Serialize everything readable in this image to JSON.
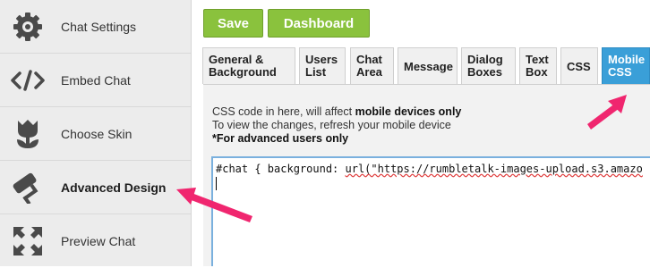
{
  "sidebar": {
    "items": [
      {
        "label": "Chat Settings",
        "icon": "gear-icon"
      },
      {
        "label": "Embed Chat",
        "icon": "code-icon"
      },
      {
        "label": "Choose Skin",
        "icon": "tulip-icon"
      },
      {
        "label": "Advanced Design",
        "icon": "paint-roller-icon",
        "active": true
      },
      {
        "label": "Preview Chat",
        "icon": "expand-icon"
      }
    ]
  },
  "toolbar": {
    "save_label": "Save",
    "dashboard_label": "Dashboard"
  },
  "tabs": [
    {
      "line1": "General &",
      "line2": "Background"
    },
    {
      "line1": "Users",
      "line2": "List"
    },
    {
      "line1": "Chat",
      "line2": "Area"
    },
    {
      "line1": "Message",
      "line2": ""
    },
    {
      "line1": "Dialog",
      "line2": "Boxes"
    },
    {
      "line1": "Text",
      "line2": "Box"
    },
    {
      "line1": "CSS",
      "line2": ""
    },
    {
      "line1": "Mobile",
      "line2": "CSS",
      "active": true
    }
  ],
  "panel": {
    "desc_line1_plain": "CSS code in here, will affect ",
    "desc_line1_bold": "mobile devices only",
    "desc_line2": "To view the changes, refresh your mobile device",
    "desc_line3": "*For advanced users only"
  },
  "editor": {
    "code_prefix": "#chat { background: ",
    "code_url": "url(\"https://rumbletalk-images-upload.s3.amazo"
  },
  "colors": {
    "accent_green": "#8ac23d",
    "active_tab_blue": "#3a9fd8",
    "annotation_arrow": "#f0266f"
  }
}
